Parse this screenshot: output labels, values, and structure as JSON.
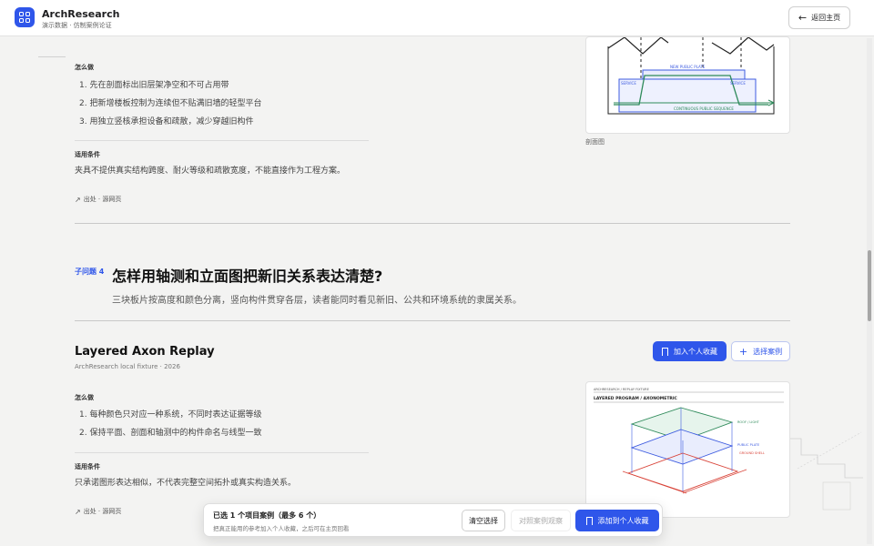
{
  "header": {
    "brand_title": "ArchResearch",
    "brand_subtitle": "演示数据 · 仿制案例论证",
    "back_label": "返回主页"
  },
  "case1": {
    "how_label": "怎么做",
    "steps": [
      "1. 先在剖面标出旧层架净空和不可占用带",
      "2. 把新增楼板控制为连续但不贴满旧墙的轻型平台",
      "3. 用独立竖核承担设备和疏散，减少穿越旧构件"
    ],
    "cond_label": "适用条件",
    "cond_text": "夹具不提供真实结构跨度、耐火等级和疏散宽度，不能直接作为工程方案。",
    "source_label": "出处 · 源网页",
    "image_caption": "剖面图",
    "diagram_labels": {
      "plate": "NEW PUBLIC PLATE",
      "service_left": "SERVICE",
      "service_right": "SERVICE",
      "continuous": "CONTINUOUS PUBLIC SEQUENCE"
    }
  },
  "subquestion": {
    "tag": "子问题 4",
    "title": "怎样用轴测和立面图把新旧关系表达清楚?",
    "description": "三块板片按高度和颜色分离，竖向构件贯穿各层，读者能同时看见新旧、公共和环境系统的隶属关系。"
  },
  "case2": {
    "title": "Layered Axon Replay",
    "meta": "ArchResearch local fixture · 2026",
    "fav_label": "加入个人收藏",
    "select_label": "选择案例",
    "how_label": "怎么做",
    "steps": [
      "1. 每种颜色只对应一种系统，不同时表达证据等级",
      "2. 保持平面、剖面和轴测中的构件命名与线型一致"
    ],
    "cond_label": "适用条件",
    "cond_text": "只承诺图形表达相似，不代表完整空间拓扑或真实构造关系。",
    "source_label": "出处 · 源网页",
    "diagram_labels": {
      "fixture": "ARCHRESEARCH / REPLAY FIXTURE",
      "heading": "LAYERED PROGRAM / AXONOMETRIC",
      "roof": "ROOF / LIGHT",
      "public": "PUBLIC PLATE",
      "ground": "GROUND SHELL"
    }
  },
  "selection_bar": {
    "title": "已选 1 个项目案例（最多 6 个）",
    "subtitle": "把真正能用的参考加入个人收藏，之后可在主页回看",
    "clear_label": "清空选择",
    "compare_label": "对照案例观察",
    "add_label": "添加到个人收藏"
  },
  "colors": {
    "accent": "#2f56ea",
    "diagram_blue": "#3d5be0",
    "diagram_green": "#2e8a5a",
    "diagram_red": "#d9453a"
  }
}
